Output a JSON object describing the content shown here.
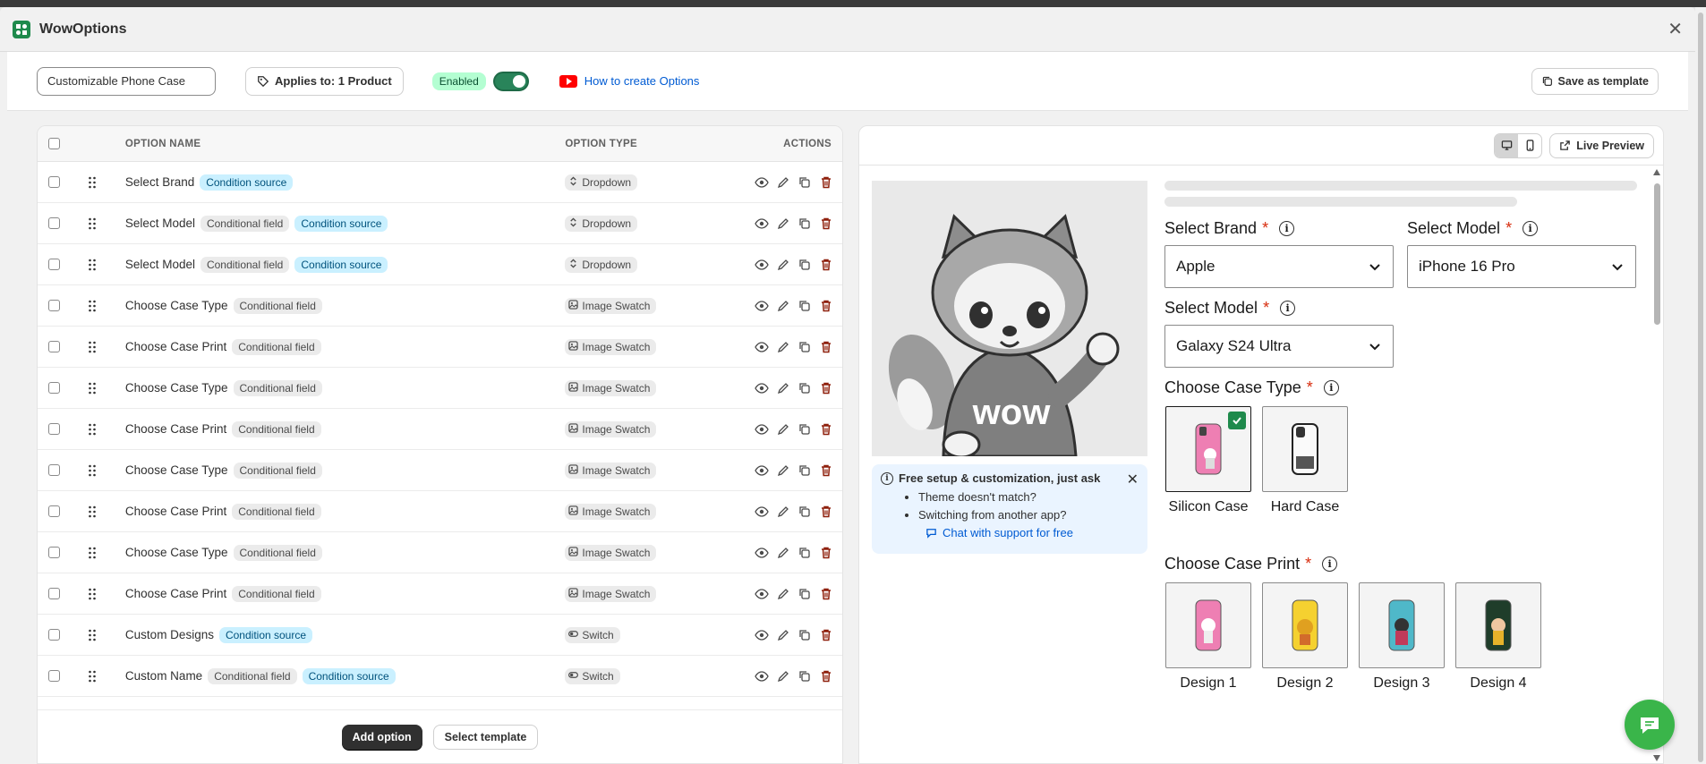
{
  "app": {
    "title": "WowOptions"
  },
  "toolbar": {
    "option_set_name": "Customizable Phone Case",
    "applies_label": "Applies to: 1 Product",
    "status_label": "Enabled",
    "enabled": true,
    "howto_label": "How to create Options",
    "save_template_label": "Save as template"
  },
  "table": {
    "headers": {
      "name": "OPTION NAME",
      "type": "OPTION TYPE",
      "actions": "ACTIONS"
    },
    "rows": [
      {
        "name": "Select Brand",
        "badges": [
          {
            "text": "Condition source",
            "kind": "blue"
          }
        ],
        "type": "Dropdown",
        "type_icon": "dropdown-icon"
      },
      {
        "name": "Select Model",
        "badges": [
          {
            "text": "Conditional field",
            "kind": "gray"
          },
          {
            "text": "Condition source",
            "kind": "blue"
          }
        ],
        "type": "Dropdown",
        "type_icon": "dropdown-icon"
      },
      {
        "name": "Select Model",
        "badges": [
          {
            "text": "Conditional field",
            "kind": "gray"
          },
          {
            "text": "Condition source",
            "kind": "blue"
          }
        ],
        "type": "Dropdown",
        "type_icon": "dropdown-icon"
      },
      {
        "name": "Choose Case Type",
        "badges": [
          {
            "text": "Conditional field",
            "kind": "gray"
          }
        ],
        "type": "Image Swatch",
        "type_icon": "image-icon"
      },
      {
        "name": "Choose Case Print",
        "badges": [
          {
            "text": "Conditional field",
            "kind": "gray"
          }
        ],
        "type": "Image Swatch",
        "type_icon": "image-icon"
      },
      {
        "name": "Choose Case Type",
        "badges": [
          {
            "text": "Conditional field",
            "kind": "gray"
          }
        ],
        "type": "Image Swatch",
        "type_icon": "image-icon"
      },
      {
        "name": "Choose Case Print",
        "badges": [
          {
            "text": "Conditional field",
            "kind": "gray"
          }
        ],
        "type": "Image Swatch",
        "type_icon": "image-icon"
      },
      {
        "name": "Choose Case Type",
        "badges": [
          {
            "text": "Conditional field",
            "kind": "gray"
          }
        ],
        "type": "Image Swatch",
        "type_icon": "image-icon"
      },
      {
        "name": "Choose Case Print",
        "badges": [
          {
            "text": "Conditional field",
            "kind": "gray"
          }
        ],
        "type": "Image Swatch",
        "type_icon": "image-icon"
      },
      {
        "name": "Choose Case Type",
        "badges": [
          {
            "text": "Conditional field",
            "kind": "gray"
          }
        ],
        "type": "Image Swatch",
        "type_icon": "image-icon"
      },
      {
        "name": "Choose Case Print",
        "badges": [
          {
            "text": "Conditional field",
            "kind": "gray"
          }
        ],
        "type": "Image Swatch",
        "type_icon": "image-icon"
      },
      {
        "name": "Custom Designs",
        "badges": [
          {
            "text": "Condition source",
            "kind": "blue"
          }
        ],
        "type": "Switch",
        "type_icon": "switch-icon"
      },
      {
        "name": "Custom Name",
        "badges": [
          {
            "text": "Conditional field",
            "kind": "gray"
          },
          {
            "text": "Condition source",
            "kind": "blue"
          }
        ],
        "type": "Switch",
        "type_icon": "switch-icon"
      }
    ],
    "add_option_label": "Add option",
    "select_template_label": "Select template"
  },
  "preview": {
    "live_preview_label": "Live Preview",
    "promo": {
      "title": "Free setup & customization, just ask",
      "bullets": [
        "Theme doesn't match?",
        "Switching from another app?"
      ],
      "chat_link": "Chat with support for free"
    },
    "hero_text": "wow",
    "select_brand": {
      "label": "Select Brand",
      "value": "Apple"
    },
    "select_model_1": {
      "label": "Select Model",
      "value": "iPhone 16 Pro"
    },
    "select_model_2": {
      "label": "Select Model",
      "value": "Galaxy S24 Ultra"
    },
    "case_type": {
      "label": "Choose Case Type",
      "options": [
        "Silicon Case",
        "Hard Case"
      ],
      "selected": "Silicon Case"
    },
    "case_print": {
      "label": "Choose Case Print",
      "options": [
        "Design 1",
        "Design 2",
        "Design 3",
        "Design 4"
      ]
    },
    "required_mark": "*"
  },
  "colors": {
    "accent_green": "#29845a",
    "link_blue": "#005bd3",
    "delete_red": "#8e1f0b",
    "required_red": "#d72c0d"
  }
}
